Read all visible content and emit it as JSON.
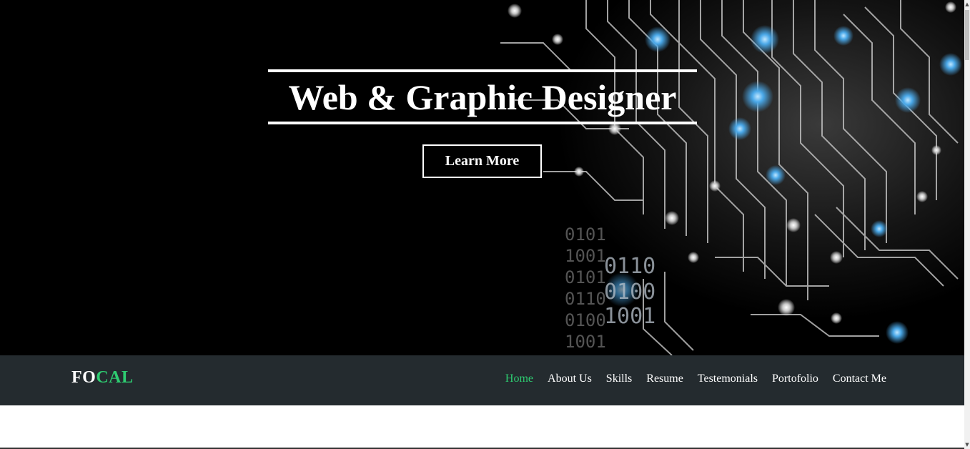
{
  "hero": {
    "title": "Web & Graphic Designer",
    "cta_label": "Learn More",
    "binary_lines": [
      "0101",
      "1001",
      "0101",
      "0110",
      "0100",
      "1001"
    ],
    "binary_big": [
      "0110",
      "0100",
      "1001"
    ],
    "background_color": "#000000"
  },
  "navbar": {
    "logo_part1": "FO",
    "logo_part2": "CAL",
    "items": [
      {
        "label": "Home",
        "active": true
      },
      {
        "label": "About Us",
        "active": false
      },
      {
        "label": "Skills",
        "active": false
      },
      {
        "label": "Resume",
        "active": false
      },
      {
        "label": "Testemonials",
        "active": false
      },
      {
        "label": "Portofolio",
        "active": false
      },
      {
        "label": "Contact Me",
        "active": false
      }
    ],
    "background_color": "#242b2f",
    "accent_color": "#2ecc71"
  }
}
